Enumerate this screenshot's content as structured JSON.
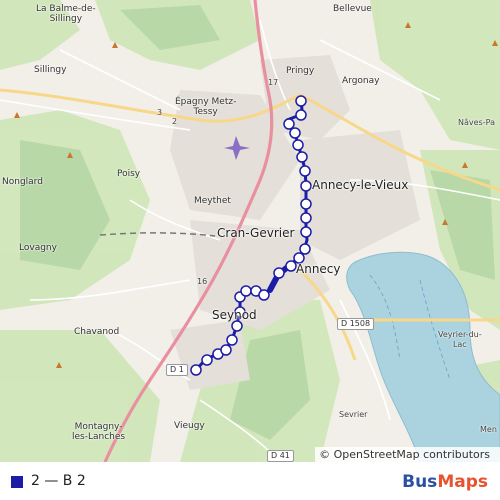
{
  "map": {
    "attribution": "© OpenStreetMap contributors",
    "place_labels": {
      "la_balme": "La Balme-de-\nSillingy",
      "bellevue": "Bellevue",
      "sillingy": "Sillingy",
      "pringy": "Pringy",
      "argonay": "Argonay",
      "epagny": "Épagny Metz-\nTessy",
      "naves": "Nâves-Pa",
      "nonglard": "Nonglard",
      "poisy": "Poisy",
      "annecy_le_vieux": "Annecy-le-Vieux",
      "meythet": "Meythet",
      "lovagny": "Lovagny",
      "cran_gevrier": "Cran-Gevrier",
      "annecy": "Annecy",
      "chavanod": "Chavanod",
      "seynod": "Seynod",
      "veyrier": "Veyrier-du-\nLac",
      "montagny": "Montagny-\nles-Lanches",
      "vieugy": "Vieugy",
      "sevrier": "Sevrier",
      "men": "Men"
    },
    "road_shields": {
      "d1508": "D 1508",
      "d1": "D 1",
      "d41": "D 41",
      "n17": "17",
      "r3": "3",
      "r2": "2",
      "r16": "16"
    },
    "route_color": "#1c1ca6"
  },
  "legend": {
    "route_label": "2 — B 2",
    "swatch_color": "#1c1ca6"
  },
  "brand": {
    "part1": "Bus",
    "part2": "Maps"
  }
}
